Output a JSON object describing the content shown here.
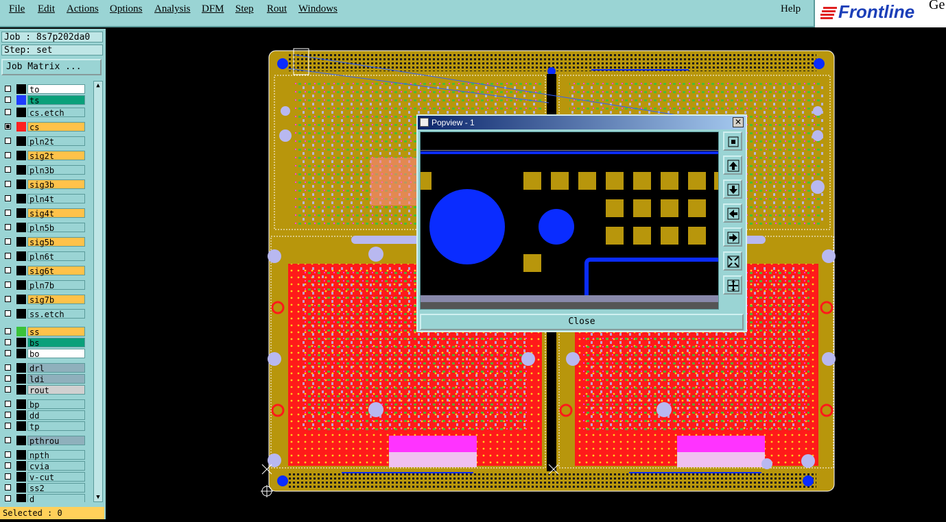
{
  "menu": {
    "items": [
      {
        "label": "File"
      },
      {
        "label": "Edit"
      },
      {
        "label": "Actions"
      },
      {
        "label": "Options"
      },
      {
        "label": "Analysis"
      },
      {
        "label": "DFM"
      },
      {
        "label": "Step"
      },
      {
        "label": "Rout"
      },
      {
        "label": "Windows"
      }
    ],
    "help": "Help"
  },
  "logo": {
    "text": "Frontline",
    "suffix": "Ge"
  },
  "sidebar": {
    "job": "Job : 8s7p202da0",
    "step": "Step: set",
    "job_matrix": "Job Matrix ...",
    "selected": "Selected : 0"
  },
  "layers": [
    {
      "name": "to",
      "bg": "#ffffff",
      "swatch": "",
      "checked": false
    },
    {
      "name": "ts",
      "bg": "#0aa07a",
      "swatch": "#1f3cff",
      "checked": false
    },
    {
      "name": "cs.etch",
      "bg": "#9ad4d4",
      "swatch": "",
      "checked": false
    },
    {
      "name": "cs",
      "bg": "#ffc24a",
      "swatch": "#ff2020",
      "checked": true
    },
    {
      "name": "pln2t",
      "bg": "#9ad4d4",
      "swatch": "",
      "checked": false
    },
    {
      "name": "sig2t",
      "bg": "#ffc24a",
      "swatch": "",
      "checked": false
    },
    {
      "name": "pln3b",
      "bg": "#9ad4d4",
      "swatch": "",
      "checked": false
    },
    {
      "name": "sig3b",
      "bg": "#ffc24a",
      "swatch": "",
      "checked": false
    },
    {
      "name": "pln4t",
      "bg": "#9ad4d4",
      "swatch": "",
      "checked": false
    },
    {
      "name": "sig4t",
      "bg": "#ffc24a",
      "swatch": "",
      "checked": false
    },
    {
      "name": "pln5b",
      "bg": "#9ad4d4",
      "swatch": "",
      "checked": false
    },
    {
      "name": "sig5b",
      "bg": "#ffc24a",
      "swatch": "",
      "checked": false
    },
    {
      "name": "pln6t",
      "bg": "#9ad4d4",
      "swatch": "",
      "checked": false
    },
    {
      "name": "sig6t",
      "bg": "#ffc24a",
      "swatch": "",
      "checked": false
    },
    {
      "name": "pln7b",
      "bg": "#9ad4d4",
      "swatch": "",
      "checked": false
    },
    {
      "name": "sig7b",
      "bg": "#ffc24a",
      "swatch": "",
      "checked": false
    },
    {
      "name": "ss.etch",
      "bg": "#9ad4d4",
      "swatch": "",
      "checked": false
    },
    {
      "name": "ss",
      "bg": "#ffc24a",
      "swatch": "#3ac23a",
      "checked": false
    },
    {
      "name": "bs",
      "bg": "#0aa07a",
      "swatch": "",
      "checked": false
    },
    {
      "name": "bo",
      "bg": "#ffffff",
      "swatch": "",
      "checked": false
    },
    {
      "name": "drl",
      "bg": "#8fb0bc",
      "swatch": "",
      "checked": false
    },
    {
      "name": "ldi",
      "bg": "#8fb0bc",
      "swatch": "",
      "checked": false
    },
    {
      "name": "rout",
      "bg": "#d0d0d0",
      "swatch": "",
      "checked": false
    },
    {
      "name": "bp",
      "bg": "#9ad4d4",
      "swatch": "",
      "checked": false
    },
    {
      "name": "dd",
      "bg": "#9ad4d4",
      "swatch": "",
      "checked": false
    },
    {
      "name": "tp",
      "bg": "#9ad4d4",
      "swatch": "",
      "checked": false
    },
    {
      "name": "pthrou",
      "bg": "#8fb0bc",
      "swatch": "",
      "checked": false
    },
    {
      "name": "npth",
      "bg": "#9ad4d4",
      "swatch": "",
      "checked": false
    },
    {
      "name": "cvia",
      "bg": "#9ad4d4",
      "swatch": "",
      "checked": false
    },
    {
      "name": "v-cut",
      "bg": "#9ad4d4",
      "swatch": "",
      "checked": false
    },
    {
      "name": "ss2",
      "bg": "#9ad4d4",
      "swatch": "",
      "checked": false
    },
    {
      "name": "d",
      "bg": "#9ad4d4",
      "swatch": "",
      "checked": false
    }
  ],
  "popview": {
    "title": "Popview - 1",
    "close_label": "Close",
    "tools": [
      {
        "icon": "zoom-home-icon"
      },
      {
        "icon": "pan-up-icon"
      },
      {
        "icon": "pan-down-icon"
      },
      {
        "icon": "pan-left-icon"
      },
      {
        "icon": "pan-right-icon"
      },
      {
        "icon": "zoom-out-icon"
      },
      {
        "icon": "zoom-in-icon"
      }
    ]
  },
  "colors": {
    "panel": "#9ad4d4",
    "board": "#b8960c",
    "copper_top": "#ff1a1a",
    "pad_blue": "#0a2cff",
    "pad_lavender": "#b8b8f0",
    "magenta": "#ff33ff"
  }
}
